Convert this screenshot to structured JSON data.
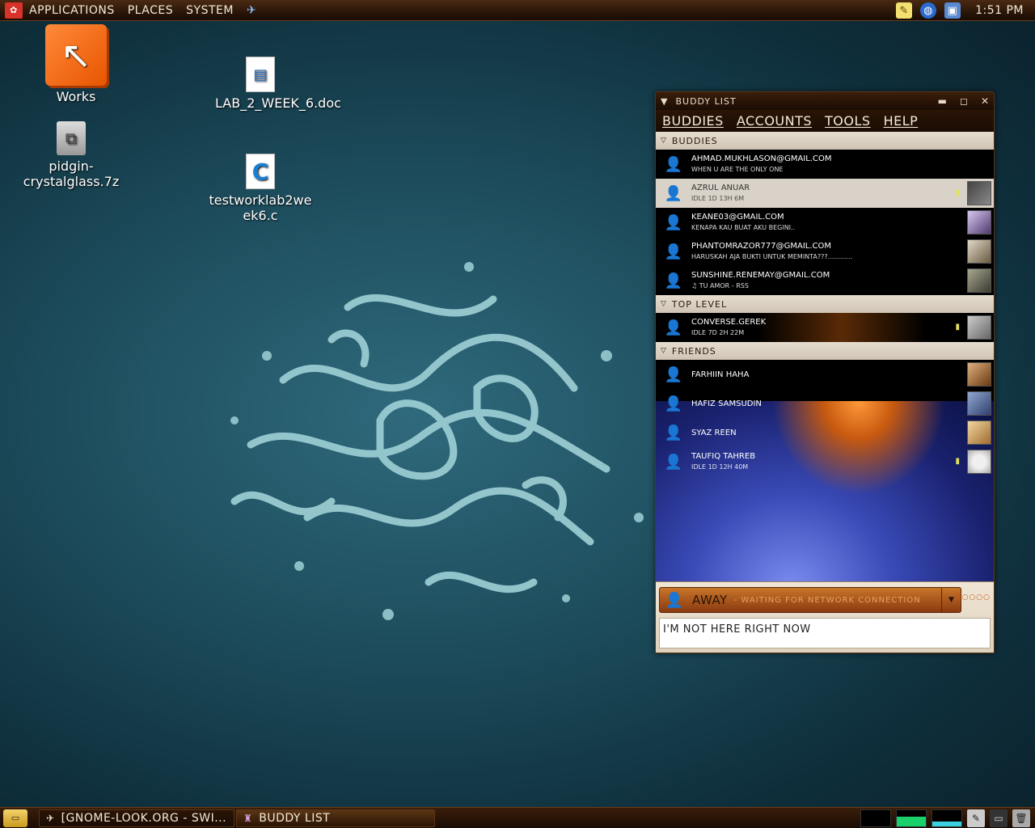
{
  "top_panel": {
    "menu": [
      "APPLICATIONS",
      "PLACES",
      "SYSTEM"
    ],
    "clock": "1:51 PM",
    "tray_icons": [
      "notes-icon",
      "network-globe-icon",
      "update-icon"
    ]
  },
  "desktop": {
    "icons": [
      {
        "label": "Works",
        "icon": "folder-icon"
      },
      {
        "label": "pidgin-crystalglass.7z",
        "icon": "archive-icon"
      },
      {
        "label": "LAB_2_WEEK_6.doc",
        "icon": "document-icon"
      },
      {
        "label": "testworklab2week6.c",
        "icon": "c-source-icon"
      }
    ]
  },
  "buddy_window": {
    "title": "BUDDY LIST",
    "menu": [
      "BUDDIES",
      "ACCOUNTS",
      "TOOLS",
      "HELP"
    ],
    "groups": [
      {
        "name": "BUDDIES",
        "buddies": [
          {
            "name": "AHMAD.MUKHLASON@GMAIL.COM",
            "status": "WHEN U ARE THE ONLY ONE"
          },
          {
            "name": "AZRUL ANUAR",
            "status": "IDLE 1D 13H 6M"
          },
          {
            "name": "KEANE03@GMAIL.COM",
            "status": "KENAPA KAU BUAT AKU BEGINI.."
          },
          {
            "name": "PHANTOMRAZOR777@GMAIL.COM",
            "status": "HARUSKAH AJA BUKTI UNTUK MEMINTA???............"
          },
          {
            "name": "SUNSHINE.RENEMAY@GMAIL.COM",
            "status": "♫ TU AMOR - RSS"
          }
        ]
      },
      {
        "name": "TOP LEVEL",
        "buddies": [
          {
            "name": "CONVERSE.GEREK",
            "status": "IDLE 7D 2H 22M"
          }
        ]
      },
      {
        "name": "FRIENDS",
        "buddies": [
          {
            "name": "FARHIIN HAHA",
            "status": ""
          },
          {
            "name": "HAFIZ SAMSUDIN",
            "status": ""
          },
          {
            "name": "SYAZ REEN",
            "status": ""
          },
          {
            "name": "TAUFIQ TAHREB",
            "status": "IDLE 1D 12H 40M"
          }
        ]
      }
    ],
    "status_selector": {
      "value": "AWAY",
      "detail": "- WAITING FOR NETWORK CONNECTION"
    },
    "connecting_label": "○○○○○",
    "status_message": "I'M NOT HERE RIGHT NOW"
  },
  "bottom_panel": {
    "tasks": [
      "[GNOME-LOOK.ORG - SWI...",
      "BUDDY LIST"
    ]
  }
}
